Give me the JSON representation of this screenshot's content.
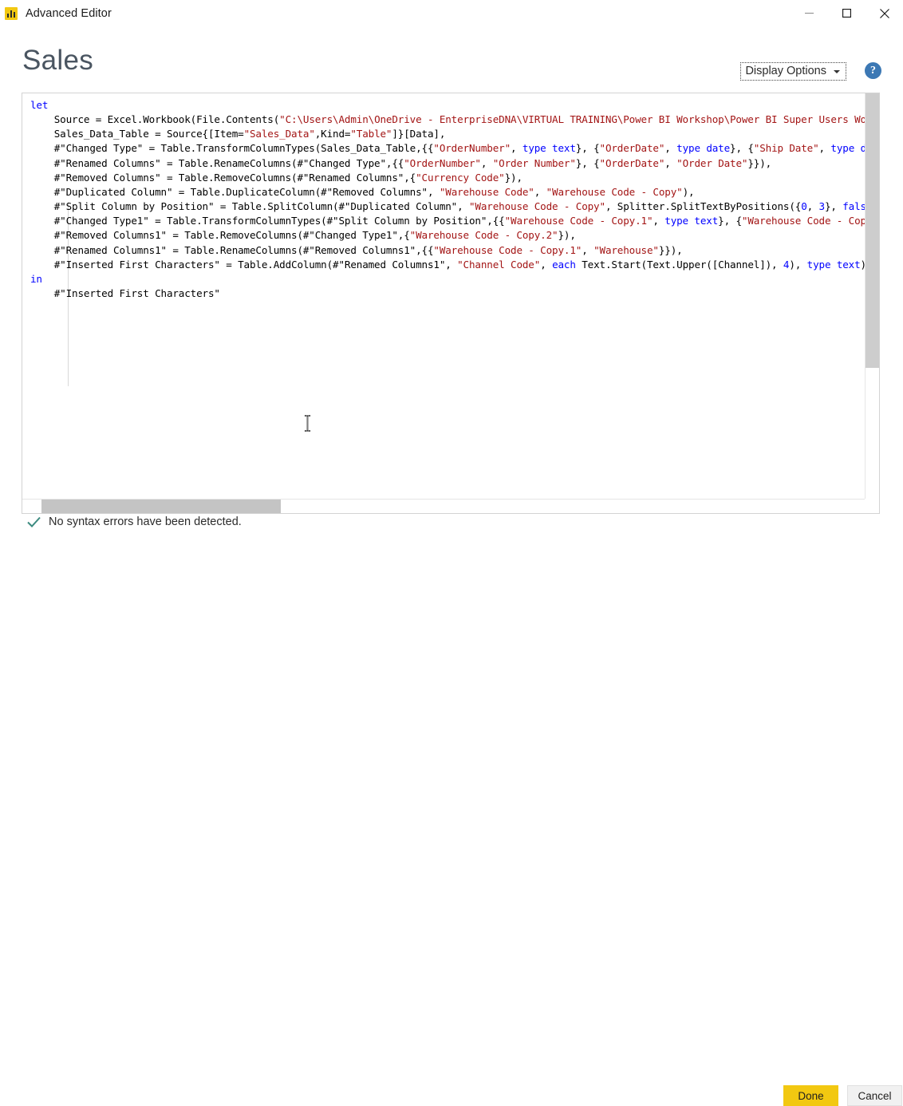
{
  "window": {
    "title": "Advanced Editor",
    "app_icon": "power-bi-bars-icon",
    "controls": {
      "minimize": "minimize-icon",
      "maximize": "maximize-icon",
      "close": "close-icon"
    }
  },
  "header": {
    "query_name": "Sales",
    "display_options_label": "Display Options",
    "display_options_caret": "chevron-down-icon",
    "help_label": "?"
  },
  "editor": {
    "lines": [
      [
        {
          "t": "let",
          "c": "kw"
        }
      ],
      [
        {
          "t": "    Source = Excel.Workbook(File.Contents(",
          "c": ""
        },
        {
          "t": "\"C:\\Users\\Admin\\OneDrive - EnterpriseDNA\\VIRTUAL TRAINING\\Power BI Workshop\\Power BI Super Users Wo",
          "c": "str"
        }
      ],
      [
        {
          "t": "    Sales_Data_Table = Source{[Item=",
          "c": ""
        },
        {
          "t": "\"Sales_Data\"",
          "c": "str"
        },
        {
          "t": ",Kind=",
          "c": ""
        },
        {
          "t": "\"Table\"",
          "c": "str"
        },
        {
          "t": "]}[Data],",
          "c": ""
        }
      ],
      [
        {
          "t": "    #\"Changed Type\" = Table.TransformColumnTypes(Sales_Data_Table,{{",
          "c": ""
        },
        {
          "t": "\"OrderNumber\"",
          "c": "str"
        },
        {
          "t": ", ",
          "c": ""
        },
        {
          "t": "type text",
          "c": "kw"
        },
        {
          "t": "}, {",
          "c": ""
        },
        {
          "t": "\"OrderDate\"",
          "c": "str"
        },
        {
          "t": ", ",
          "c": ""
        },
        {
          "t": "type date",
          "c": "kw"
        },
        {
          "t": "}, {",
          "c": ""
        },
        {
          "t": "\"Ship Date\"",
          "c": "str"
        },
        {
          "t": ", ",
          "c": ""
        },
        {
          "t": "type d",
          "c": "kw"
        }
      ],
      [
        {
          "t": "    #\"Renamed Columns\" = Table.RenameColumns(#\"Changed Type\",{{",
          "c": ""
        },
        {
          "t": "\"OrderNumber\"",
          "c": "str"
        },
        {
          "t": ", ",
          "c": ""
        },
        {
          "t": "\"Order Number\"",
          "c": "str"
        },
        {
          "t": "}, {",
          "c": ""
        },
        {
          "t": "\"OrderDate\"",
          "c": "str"
        },
        {
          "t": ", ",
          "c": ""
        },
        {
          "t": "\"Order Date\"",
          "c": "str"
        },
        {
          "t": "}}),",
          "c": ""
        }
      ],
      [
        {
          "t": "    #\"Removed Columns\" = Table.RemoveColumns(#\"Renamed Columns\",{",
          "c": ""
        },
        {
          "t": "\"Currency Code\"",
          "c": "str"
        },
        {
          "t": "}),",
          "c": ""
        }
      ],
      [
        {
          "t": "    #\"Duplicated Column\" = Table.DuplicateColumn(#\"Removed Columns\", ",
          "c": ""
        },
        {
          "t": "\"Warehouse Code\"",
          "c": "str"
        },
        {
          "t": ", ",
          "c": ""
        },
        {
          "t": "\"Warehouse Code - Copy\"",
          "c": "str"
        },
        {
          "t": "),",
          "c": ""
        }
      ],
      [
        {
          "t": "    #\"Split Column by Position\" = Table.SplitColumn(#\"Duplicated Column\", ",
          "c": ""
        },
        {
          "t": "\"Warehouse Code - Copy\"",
          "c": "str"
        },
        {
          "t": ", Splitter.SplitTextByPositions({",
          "c": ""
        },
        {
          "t": "0",
          "c": "num"
        },
        {
          "t": ", ",
          "c": ""
        },
        {
          "t": "3",
          "c": "num"
        },
        {
          "t": "}, ",
          "c": ""
        },
        {
          "t": "fals",
          "c": "kw"
        }
      ],
      [
        {
          "t": "    #\"Changed Type1\" = Table.TransformColumnTypes(#\"Split Column by Position\",{{",
          "c": ""
        },
        {
          "t": "\"Warehouse Code - Copy.1\"",
          "c": "str"
        },
        {
          "t": ", ",
          "c": ""
        },
        {
          "t": "type text",
          "c": "kw"
        },
        {
          "t": "}, {",
          "c": ""
        },
        {
          "t": "\"Warehouse Code - Cop",
          "c": "str"
        }
      ],
      [
        {
          "t": "    #\"Removed Columns1\" = Table.RemoveColumns(#\"Changed Type1\",{",
          "c": ""
        },
        {
          "t": "\"Warehouse Code - Copy.2\"",
          "c": "str"
        },
        {
          "t": "}),",
          "c": ""
        }
      ],
      [
        {
          "t": "    #\"Renamed Columns1\" = Table.RenameColumns(#\"Removed Columns1\",{{",
          "c": ""
        },
        {
          "t": "\"Warehouse Code - Copy.1\"",
          "c": "str"
        },
        {
          "t": ", ",
          "c": ""
        },
        {
          "t": "\"Warehouse\"",
          "c": "str"
        },
        {
          "t": "}}),",
          "c": ""
        }
      ],
      [
        {
          "t": "    #\"Inserted First Characters\" = Table.AddColumn(#\"Renamed Columns1\", ",
          "c": ""
        },
        {
          "t": "\"Channel Code\"",
          "c": "str"
        },
        {
          "t": ", ",
          "c": ""
        },
        {
          "t": "each",
          "c": "kw"
        },
        {
          "t": " Text.Start(Text.Upper([Channel]), ",
          "c": ""
        },
        {
          "t": "4",
          "c": "num"
        },
        {
          "t": "), ",
          "c": ""
        },
        {
          "t": "type text",
          "c": "kw"
        },
        {
          "t": ")",
          "c": ""
        }
      ],
      [
        {
          "t": "in",
          "c": "kw"
        }
      ],
      [
        {
          "t": "    #\"Inserted First Characters\"",
          "c": ""
        }
      ]
    ],
    "scroll": {
      "vertical_thumb": "vertical-scrollbar-thumb",
      "horizontal_thumb": "horizontal-scrollbar-thumb"
    }
  },
  "status": {
    "icon": "checkmark-icon",
    "message": "No syntax errors have been detected."
  },
  "footer": {
    "done_label": "Done",
    "cancel_label": "Cancel"
  },
  "colors": {
    "brand_yellow": "#F2C811",
    "keyword_blue": "#0000FF",
    "string_red": "#A31515",
    "help_blue": "#3C78B4",
    "status_check_green": "#3D8B80",
    "title_slate": "#4A5561"
  }
}
